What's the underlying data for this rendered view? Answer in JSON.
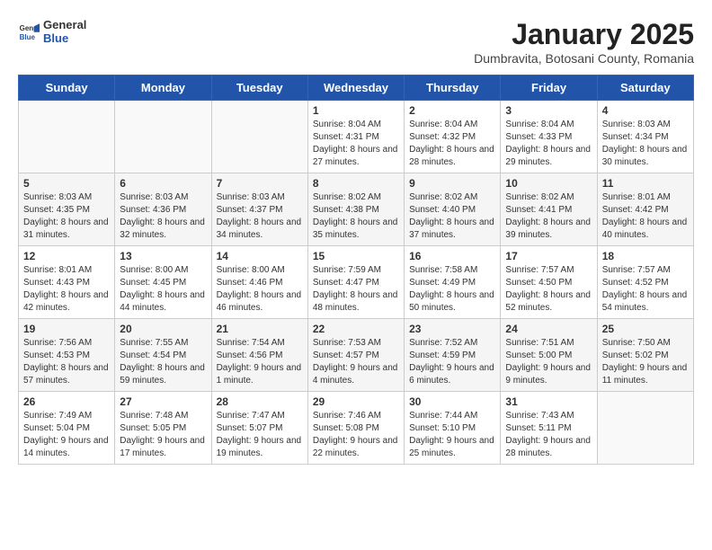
{
  "header": {
    "logo_general": "General",
    "logo_blue": "Blue",
    "title": "January 2025",
    "subtitle": "Dumbravita, Botosani County, Romania"
  },
  "days": [
    "Sunday",
    "Monday",
    "Tuesday",
    "Wednesday",
    "Thursday",
    "Friday",
    "Saturday"
  ],
  "weeks": [
    [
      {
        "date": "",
        "info": ""
      },
      {
        "date": "",
        "info": ""
      },
      {
        "date": "",
        "info": ""
      },
      {
        "date": "1",
        "info": "Sunrise: 8:04 AM\nSunset: 4:31 PM\nDaylight: 8 hours and 27 minutes."
      },
      {
        "date": "2",
        "info": "Sunrise: 8:04 AM\nSunset: 4:32 PM\nDaylight: 8 hours and 28 minutes."
      },
      {
        "date": "3",
        "info": "Sunrise: 8:04 AM\nSunset: 4:33 PM\nDaylight: 8 hours and 29 minutes."
      },
      {
        "date": "4",
        "info": "Sunrise: 8:03 AM\nSunset: 4:34 PM\nDaylight: 8 hours and 30 minutes."
      }
    ],
    [
      {
        "date": "5",
        "info": "Sunrise: 8:03 AM\nSunset: 4:35 PM\nDaylight: 8 hours and 31 minutes."
      },
      {
        "date": "6",
        "info": "Sunrise: 8:03 AM\nSunset: 4:36 PM\nDaylight: 8 hours and 32 minutes."
      },
      {
        "date": "7",
        "info": "Sunrise: 8:03 AM\nSunset: 4:37 PM\nDaylight: 8 hours and 34 minutes."
      },
      {
        "date": "8",
        "info": "Sunrise: 8:02 AM\nSunset: 4:38 PM\nDaylight: 8 hours and 35 minutes."
      },
      {
        "date": "9",
        "info": "Sunrise: 8:02 AM\nSunset: 4:40 PM\nDaylight: 8 hours and 37 minutes."
      },
      {
        "date": "10",
        "info": "Sunrise: 8:02 AM\nSunset: 4:41 PM\nDaylight: 8 hours and 39 minutes."
      },
      {
        "date": "11",
        "info": "Sunrise: 8:01 AM\nSunset: 4:42 PM\nDaylight: 8 hours and 40 minutes."
      }
    ],
    [
      {
        "date": "12",
        "info": "Sunrise: 8:01 AM\nSunset: 4:43 PM\nDaylight: 8 hours and 42 minutes."
      },
      {
        "date": "13",
        "info": "Sunrise: 8:00 AM\nSunset: 4:45 PM\nDaylight: 8 hours and 44 minutes."
      },
      {
        "date": "14",
        "info": "Sunrise: 8:00 AM\nSunset: 4:46 PM\nDaylight: 8 hours and 46 minutes."
      },
      {
        "date": "15",
        "info": "Sunrise: 7:59 AM\nSunset: 4:47 PM\nDaylight: 8 hours and 48 minutes."
      },
      {
        "date": "16",
        "info": "Sunrise: 7:58 AM\nSunset: 4:49 PM\nDaylight: 8 hours and 50 minutes."
      },
      {
        "date": "17",
        "info": "Sunrise: 7:57 AM\nSunset: 4:50 PM\nDaylight: 8 hours and 52 minutes."
      },
      {
        "date": "18",
        "info": "Sunrise: 7:57 AM\nSunset: 4:52 PM\nDaylight: 8 hours and 54 minutes."
      }
    ],
    [
      {
        "date": "19",
        "info": "Sunrise: 7:56 AM\nSunset: 4:53 PM\nDaylight: 8 hours and 57 minutes."
      },
      {
        "date": "20",
        "info": "Sunrise: 7:55 AM\nSunset: 4:54 PM\nDaylight: 8 hours and 59 minutes."
      },
      {
        "date": "21",
        "info": "Sunrise: 7:54 AM\nSunset: 4:56 PM\nDaylight: 9 hours and 1 minute."
      },
      {
        "date": "22",
        "info": "Sunrise: 7:53 AM\nSunset: 4:57 PM\nDaylight: 9 hours and 4 minutes."
      },
      {
        "date": "23",
        "info": "Sunrise: 7:52 AM\nSunset: 4:59 PM\nDaylight: 9 hours and 6 minutes."
      },
      {
        "date": "24",
        "info": "Sunrise: 7:51 AM\nSunset: 5:00 PM\nDaylight: 9 hours and 9 minutes."
      },
      {
        "date": "25",
        "info": "Sunrise: 7:50 AM\nSunset: 5:02 PM\nDaylight: 9 hours and 11 minutes."
      }
    ],
    [
      {
        "date": "26",
        "info": "Sunrise: 7:49 AM\nSunset: 5:04 PM\nDaylight: 9 hours and 14 minutes."
      },
      {
        "date": "27",
        "info": "Sunrise: 7:48 AM\nSunset: 5:05 PM\nDaylight: 9 hours and 17 minutes."
      },
      {
        "date": "28",
        "info": "Sunrise: 7:47 AM\nSunset: 5:07 PM\nDaylight: 9 hours and 19 minutes."
      },
      {
        "date": "29",
        "info": "Sunrise: 7:46 AM\nSunset: 5:08 PM\nDaylight: 9 hours and 22 minutes."
      },
      {
        "date": "30",
        "info": "Sunrise: 7:44 AM\nSunset: 5:10 PM\nDaylight: 9 hours and 25 minutes."
      },
      {
        "date": "31",
        "info": "Sunrise: 7:43 AM\nSunset: 5:11 PM\nDaylight: 9 hours and 28 minutes."
      },
      {
        "date": "",
        "info": ""
      }
    ]
  ]
}
